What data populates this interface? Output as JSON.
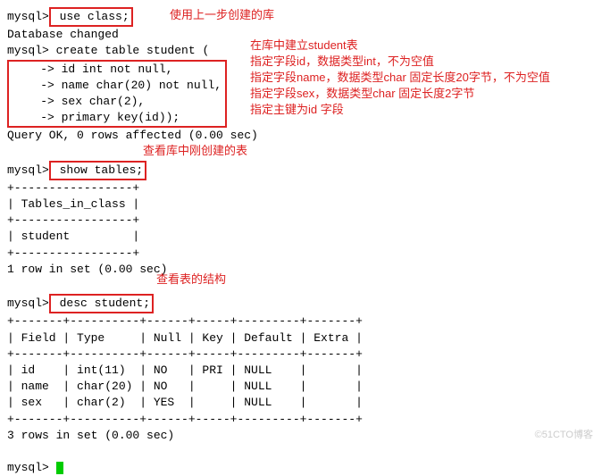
{
  "term": {
    "prompt": "mysql>",
    "cont": "    ->",
    "cmd_use": " use class;",
    "db_changed": "Database changed",
    "create1": " create table student (",
    "create2": " id int not null,",
    "create3": " name char(20) not null,",
    "create4": " sex char(2),",
    "create5": " primary key(id));",
    "query_ok": "Query OK, 0 rows affected (0.00 sec)",
    "cmd_show": " show tables;",
    "tb_border": "+-----------------+",
    "tb_header": "| Tables_in_class |",
    "tb_row": "| student         |",
    "one_row": "1 row in set (0.00 sec)",
    "cmd_desc": " desc student;",
    "d_border": "+-------+----------+------+-----+---------+-------+",
    "d_header": "| Field | Type     | Null | Key | Default | Extra |",
    "d_row1": "| id    | int(11)  | NO   | PRI | NULL    |       |",
    "d_row2": "| name  | char(20) | NO   |     | NULL    |       |",
    "d_row3": "| sex   | char(2)  | YES  |     | NULL    |       |",
    "three_rows": "3 rows in set (0.00 sec)"
  },
  "anno": {
    "a1": "使用上一步创建的库",
    "a2": "在库中建立student表",
    "a3": "指定字段id，数据类型int，不为空值",
    "a4": "指定字段name，数据类型char 固定长度20字节，不为空值",
    "a5": "指定字段sex，数据类型char 固定长度2字节",
    "a6": "指定主键为id 字段",
    "a7": "查看库中刚创建的表",
    "a8": "查看表的结构"
  },
  "watermark": "©51CTO博客"
}
